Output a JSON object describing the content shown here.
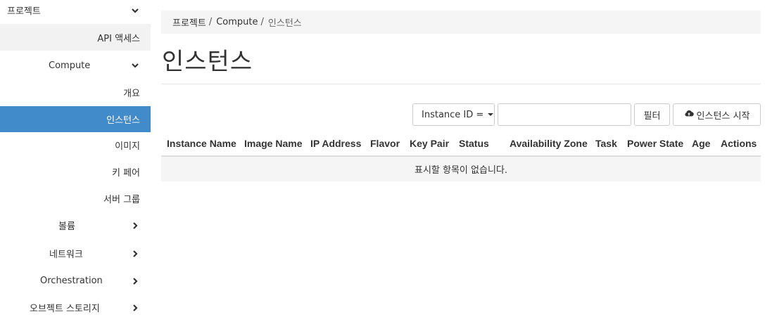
{
  "sidebar": {
    "project": "프로젝트",
    "api_access": "API 액세스",
    "compute": "Compute",
    "overview": "개요",
    "instances": "인스턴스",
    "images": "이미지",
    "key_pairs": "키 페어",
    "server_groups": "서버 그룹",
    "volumes": "볼륨",
    "network": "네트워크",
    "orchestration": "Orchestration",
    "object_store": "오브젝트 스토리지"
  },
  "breadcrumb": {
    "project": "프로젝트",
    "compute": "Compute",
    "current": "인스턴스",
    "separator": "/"
  },
  "page": {
    "title": "인스턴스"
  },
  "filter": {
    "field_label": "Instance ID =",
    "input_value": "",
    "filter_button": "필터",
    "launch_button": "인스턴스 시작"
  },
  "table": {
    "columns": [
      "Instance Name",
      "Image Name",
      "IP Address",
      "Flavor",
      "Key Pair",
      "Status",
      "Availability Zone",
      "Task",
      "Power State",
      "Age",
      "Actions"
    ],
    "empty_message": "표시할 항목이 없습니다."
  },
  "colors": {
    "active_bg": "#428bca",
    "breadcrumb_bg": "#f5f5f5"
  },
  "icons": {
    "chevron_down": "chevron-down-icon",
    "chevron_right": "chevron-right-icon",
    "cloud_upload": "cloud-upload-icon"
  }
}
